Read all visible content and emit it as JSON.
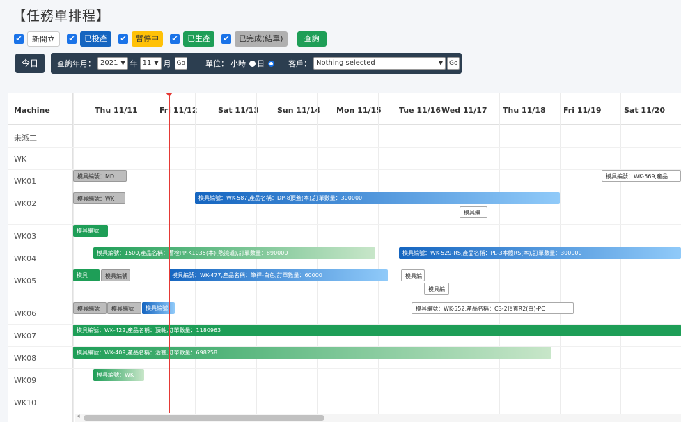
{
  "title": "【任務單排程】",
  "filters": [
    {
      "label": "新開立",
      "checked": true,
      "style": "new"
    },
    {
      "label": "已投產",
      "checked": true,
      "style": "inv"
    },
    {
      "label": "暫停中",
      "checked": true,
      "style": "pause"
    },
    {
      "label": "已生產",
      "checked": true,
      "style": "prod"
    },
    {
      "label": "已完成(結單)",
      "checked": true,
      "style": "done"
    }
  ],
  "checkmark": "✔",
  "query_button": "查詢",
  "today_button": "今日",
  "toolbar": {
    "year_month_label": "查詢年月：",
    "year_value": "2021",
    "year_suffix": "年",
    "month_value": "11",
    "month_suffix": "月",
    "go": "Go",
    "unit_label": "單位：",
    "unit_hour": "小時",
    "unit_day": "日",
    "customer_label": "客戶：",
    "customer_value": "Nothing selected",
    "go2": "Go"
  },
  "gantt": {
    "machine_header": "Machine",
    "days": [
      "Thu 11/11",
      "Fri 11/12",
      "Sat 11/13",
      "Sun 11/14",
      "Mon 11/15",
      "Tue 11/16",
      "Wed 11/17",
      "Thu 11/18",
      "Fri 11/19",
      "Sat 11/20"
    ],
    "rows": [
      "未派工",
      "WK",
      "WK01",
      "WK02",
      "WK03",
      "WK04",
      "WK05",
      "WK06",
      "WK07",
      "WK08",
      "WK09",
      "WK10"
    ],
    "bars": [
      {
        "row": "WK01",
        "text": "模具編號：MD",
        "color": "grey"
      },
      {
        "row": "WK01",
        "text": "模具編號：WK-569,產品",
        "color": "white"
      },
      {
        "row": "WK02",
        "text": "模具編號：WK",
        "color": "grey"
      },
      {
        "row": "WK02",
        "text": "模具編號：WK-587,產品名稱：DP-8頂蓋(本),訂單數量：300000",
        "color": "blue"
      },
      {
        "row": "WK02",
        "text": "模具編",
        "color": "white"
      },
      {
        "row": "WK03",
        "text": "模具編號",
        "color": "greenS"
      },
      {
        "row": "WK04",
        "text": "模具編號：1500,產品名稱：蓄栓PP-K1035(本)(熱澆道),訂單數量：890000",
        "color": "green"
      },
      {
        "row": "WK04",
        "text": "模具編號：WK-529-RS,產品名稱：PL-3本體RS(本),訂單數量：300000",
        "color": "blue"
      },
      {
        "row": "WK05",
        "text": "模具",
        "color": "greenS"
      },
      {
        "row": "WK05",
        "text": "模具編號",
        "color": "grey"
      },
      {
        "row": "WK05",
        "text": "模具編號：WK-477,產品名稱：筆桿-白色,訂單數量：60000",
        "color": "blue"
      },
      {
        "row": "WK05",
        "text": "模具編",
        "color": "white"
      },
      {
        "row": "WK05",
        "text": "模具編",
        "color": "white"
      },
      {
        "row": "WK06",
        "text": "模具編號",
        "color": "grey"
      },
      {
        "row": "WK06",
        "text": "模具編號",
        "color": "grey"
      },
      {
        "row": "WK06",
        "text": "模具編號",
        "color": "blue"
      },
      {
        "row": "WK06",
        "text": "模具編號：WK-552,產品名稱：CS-2頂蓋R2(白)-PC",
        "color": "white"
      },
      {
        "row": "WK07",
        "text": "模具編號：WK-422,產品名稱：頂軸,訂單數量：1180963",
        "color": "greenS"
      },
      {
        "row": "WK08",
        "text": "模具編號：WK-409,產品名稱：活塞,訂單數量：698258",
        "color": "green"
      },
      {
        "row": "WK09",
        "text": "模具編號：WK",
        "color": "green"
      }
    ]
  }
}
